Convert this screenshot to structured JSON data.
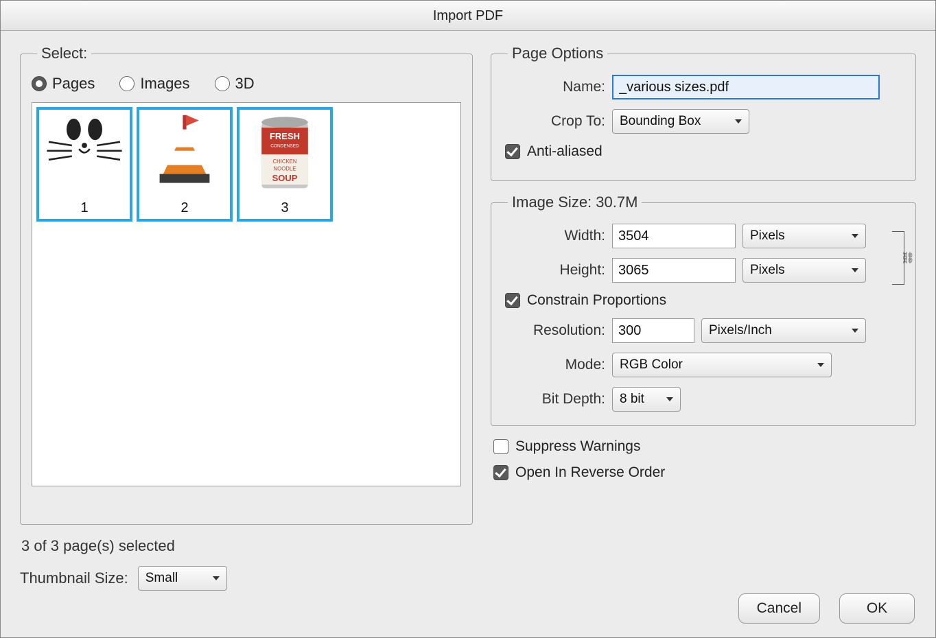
{
  "title": "Import PDF",
  "select": {
    "legend": "Select:",
    "radios": {
      "pages": "Pages",
      "images": "Images",
      "threeD": "3D",
      "active": "pages"
    },
    "thumbs": [
      {
        "num": "1",
        "art": "cat"
      },
      {
        "num": "2",
        "art": "buoy"
      },
      {
        "num": "3",
        "art": "soup"
      }
    ],
    "selected_text": "3 of 3 page(s) selected",
    "thumb_size_label": "Thumbnail Size:",
    "thumb_size_value": "Small"
  },
  "page_options": {
    "legend": "Page Options",
    "name_label": "Name:",
    "name_value": "_various sizes.pdf",
    "crop_label": "Crop To:",
    "crop_value": "Bounding Box",
    "anti_aliased_label": "Anti-aliased",
    "anti_aliased_checked": true
  },
  "image_size": {
    "legend": "Image Size: 30.7M",
    "width_label": "Width:",
    "width_value": "3504",
    "width_unit": "Pixels",
    "height_label": "Height:",
    "height_value": "3065",
    "height_unit": "Pixels",
    "constrain_label": "Constrain Proportions",
    "constrain_checked": true,
    "resolution_label": "Resolution:",
    "resolution_value": "300",
    "resolution_unit": "Pixels/Inch",
    "mode_label": "Mode:",
    "mode_value": "RGB Color",
    "bitdepth_label": "Bit Depth:",
    "bitdepth_value": "8 bit"
  },
  "suppress_label": "Suppress Warnings",
  "suppress_checked": false,
  "reverse_label": "Open In Reverse Order",
  "reverse_checked": true,
  "buttons": {
    "cancel": "Cancel",
    "ok": "OK"
  }
}
